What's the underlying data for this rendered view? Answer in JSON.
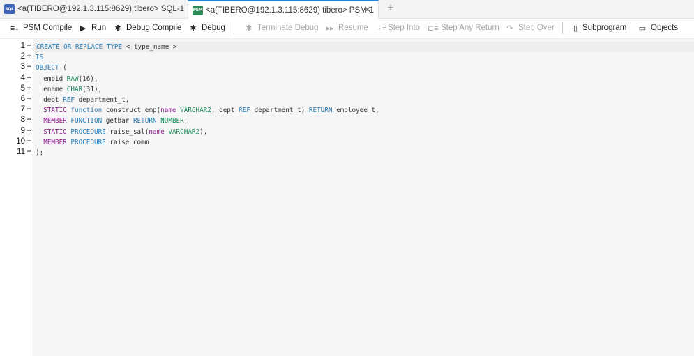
{
  "tabs": [
    {
      "icon": "SQL",
      "label": "<a(TIBERO@192.1.3.115:8629) tibero> SQL-1",
      "active": false
    },
    {
      "icon": "PSM",
      "label": "<a(TIBERO@192.1.3.115:8629) tibero> PSM-1",
      "active": true,
      "close": "✕"
    }
  ],
  "tab_add": "+",
  "toolbar": {
    "psm_compile": "PSM Compile",
    "run": "Run",
    "debug_compile": "Debug Compile",
    "debug": "Debug",
    "terminate_debug": "Terminate Debug",
    "resume": "Resume",
    "step_into": "Step Into",
    "step_any_return": "Step Any Return",
    "step_over": "Step Over",
    "subprogram": "Subprogram",
    "objects": "Objects"
  },
  "editor": {
    "line_numbers": [
      "1",
      "2",
      "3",
      "4",
      "5",
      "6",
      "7",
      "8",
      "9",
      "10",
      "11"
    ],
    "fold_marker": "+",
    "lines": [
      [
        {
          "t": "CREATE OR REPLACE TYPE",
          "c": "kw"
        },
        {
          "t": " < type_name >",
          "c": ""
        }
      ],
      [
        {
          "t": "IS",
          "c": "kw"
        }
      ],
      [
        {
          "t": "OBJECT",
          "c": "kw"
        },
        {
          "t": " (",
          "c": ""
        }
      ],
      [
        {
          "t": "  empid ",
          "c": ""
        },
        {
          "t": "RAW",
          "c": "ty"
        },
        {
          "t": "(16),",
          "c": ""
        }
      ],
      [
        {
          "t": "  ename ",
          "c": ""
        },
        {
          "t": "CHAR",
          "c": "ty"
        },
        {
          "t": "(31),",
          "c": ""
        }
      ],
      [
        {
          "t": "  dept ",
          "c": ""
        },
        {
          "t": "REF",
          "c": "kw"
        },
        {
          "t": " department_t,",
          "c": ""
        }
      ],
      [
        {
          "t": "  STATIC",
          "c": "kw2"
        },
        {
          "t": " ",
          "c": ""
        },
        {
          "t": "function",
          "c": "kw"
        },
        {
          "t": " construct_emp(",
          "c": ""
        },
        {
          "t": "name",
          "c": "kw2"
        },
        {
          "t": " ",
          "c": ""
        },
        {
          "t": "VARCHAR2",
          "c": "ty"
        },
        {
          "t": ", dept ",
          "c": ""
        },
        {
          "t": "REF",
          "c": "kw"
        },
        {
          "t": " department_t) ",
          "c": ""
        },
        {
          "t": "RETURN",
          "c": "kw"
        },
        {
          "t": " employee_t,",
          "c": ""
        }
      ],
      [
        {
          "t": "  MEMBER",
          "c": "kw2"
        },
        {
          "t": " ",
          "c": ""
        },
        {
          "t": "FUNCTION",
          "c": "kw"
        },
        {
          "t": " getbar ",
          "c": ""
        },
        {
          "t": "RETURN",
          "c": "kw"
        },
        {
          "t": " ",
          "c": ""
        },
        {
          "t": "NUMBER",
          "c": "ty"
        },
        {
          "t": ",",
          "c": ""
        }
      ],
      [
        {
          "t": "  STATIC",
          "c": "kw2"
        },
        {
          "t": " ",
          "c": ""
        },
        {
          "t": "PROCEDURE",
          "c": "kw"
        },
        {
          "t": " raise_sal(",
          "c": ""
        },
        {
          "t": "name",
          "c": "kw2"
        },
        {
          "t": " ",
          "c": ""
        },
        {
          "t": "VARCHAR2",
          "c": "ty"
        },
        {
          "t": "),",
          "c": ""
        }
      ],
      [
        {
          "t": "  MEMBER",
          "c": "kw2"
        },
        {
          "t": " ",
          "c": ""
        },
        {
          "t": "PROCEDURE",
          "c": "kw"
        },
        {
          "t": " raise_comm",
          "c": ""
        }
      ],
      [
        {
          "t": ");",
          "c": ""
        }
      ]
    ]
  },
  "colors": {
    "keyword": "#2b7fb8",
    "modifier": "#8b1b8f",
    "type": "#1b8a5a",
    "accent": "#2f7fcf"
  }
}
